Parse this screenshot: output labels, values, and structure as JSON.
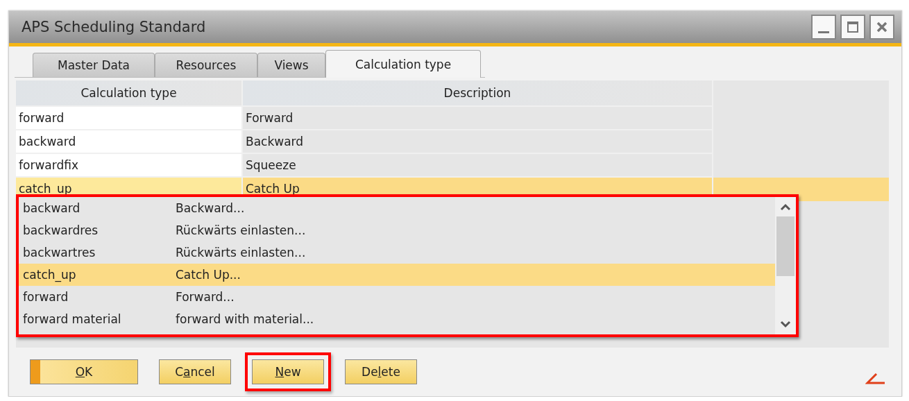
{
  "window": {
    "title": "APS Scheduling Standard"
  },
  "tabs": [
    {
      "label": "Master Data",
      "selected": false
    },
    {
      "label": "Resources",
      "selected": false
    },
    {
      "label": "Views",
      "selected": false
    },
    {
      "label": "Calculation type",
      "selected": true
    }
  ],
  "table": {
    "columns": [
      "Calculation type",
      "Description"
    ],
    "rows": [
      {
        "cells": [
          "forward",
          "Forward"
        ],
        "selected": false
      },
      {
        "cells": [
          "backward",
          "Backward"
        ],
        "selected": false
      },
      {
        "cells": [
          "forwardfix",
          "Squeeze"
        ],
        "selected": false
      },
      {
        "cells": [
          "catch_up",
          "Catch Up"
        ],
        "selected": true
      }
    ]
  },
  "dropdown": {
    "highlighted": true,
    "rows": [
      {
        "code": "backward",
        "description": "Backward...",
        "selected": false
      },
      {
        "code": "backwardres",
        "description": "Rückwärts einlasten...",
        "selected": false
      },
      {
        "code": "backwartres",
        "description": "Rückwärts einlasten...",
        "selected": false
      },
      {
        "code": "catch_up",
        "description": "Catch Up...",
        "selected": true
      },
      {
        "code": "forward",
        "description": "Forward...",
        "selected": false
      },
      {
        "code": "forward material",
        "description": "forward with material...",
        "selected": false
      }
    ]
  },
  "buttons": [
    {
      "mnemonic": "O",
      "after": "K",
      "default": true,
      "highlighted": false
    },
    {
      "before": "C",
      "mnemonic": "a",
      "after": "ncel",
      "default": false,
      "highlighted": false
    },
    {
      "mnemonic": "N",
      "after": "ew",
      "default": false,
      "highlighted": true
    },
    {
      "before": "De",
      "mnemonic": "l",
      "after": "ete",
      "default": false,
      "highlighted": false
    }
  ]
}
